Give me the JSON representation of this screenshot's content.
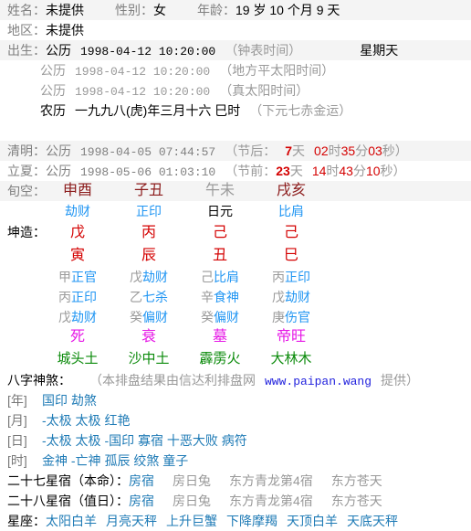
{
  "header": {
    "name_label": "姓名：",
    "name_value": "未提供",
    "gender_label": "性别：",
    "gender_value": "女",
    "age_label": "年龄：",
    "age_value": "19 岁 10 个月 9 天",
    "region_label": "地区：",
    "region_value": "未提供"
  },
  "birth": {
    "label": "出生：",
    "lines": [
      {
        "calendar": "公历",
        "datetime": "1998-04-12 10:20:00",
        "note": "（钟表时间）",
        "weekday": "星期天",
        "dim": false
      },
      {
        "calendar": "公历",
        "datetime": "1998-04-12 10:20:00",
        "note": "（地方平太阳时间）",
        "weekday": "",
        "dim": true
      },
      {
        "calendar": "公历",
        "datetime": "1998-04-12 10:20:00",
        "note": "（真太阳时间）",
        "weekday": "",
        "dim": true
      }
    ],
    "lunar": {
      "calendar": "农历",
      "text": "一九九八(虎)年三月十六  巳时",
      "note": "（下元七赤金运）"
    }
  },
  "terms": [
    {
      "name": "清明：",
      "calendar": "公历",
      "datetime": "1998-04-05 07:44:57",
      "prefix": "（节后：",
      "days": "7",
      "days_unit": "天",
      "hours": "02",
      "hours_unit": "时",
      "minutes": "35",
      "minutes_unit": "分",
      "seconds": "03",
      "seconds_unit": "秒）"
    },
    {
      "name": "立夏：",
      "calendar": "公历",
      "datetime": "1998-05-06 01:03:10",
      "prefix": "（节前：",
      "days": "23",
      "days_unit": "天",
      "hours": "14",
      "hours_unit": "时",
      "minutes": "43",
      "minutes_unit": "分",
      "seconds": "10",
      "seconds_unit": "秒）"
    }
  ],
  "chart": {
    "xunkong_label": "旬空：",
    "xunkong": [
      "申酉",
      "子丑",
      "午未",
      "戌亥"
    ],
    "xunkong_empty_index": 2,
    "tengod_top": [
      "劫财",
      "正印",
      "日元",
      "比肩"
    ],
    "tengod_top_daymaster_index": 2,
    "pillar_label": "坤造：",
    "heavenly_stems": [
      "戊",
      "丙",
      "己",
      "己"
    ],
    "earthly_branches": [
      "寅",
      "辰",
      "丑",
      "巳"
    ],
    "hidden": [
      [
        {
          "stem": "甲",
          "god": "正官"
        },
        {
          "stem": "戊",
          "god": "劫财"
        },
        {
          "stem": "己",
          "god": "比肩"
        },
        {
          "stem": "丙",
          "god": "正印"
        }
      ],
      [
        {
          "stem": "丙",
          "god": "正印"
        },
        {
          "stem": "乙",
          "god": "七杀"
        },
        {
          "stem": "辛",
          "god": "食神"
        },
        {
          "stem": "戊",
          "god": "劫财"
        }
      ],
      [
        {
          "stem": "戊",
          "god": "劫财"
        },
        {
          "stem": "癸",
          "god": "偏财"
        },
        {
          "stem": "癸",
          "god": "偏财"
        },
        {
          "stem": "庚",
          "god": "伤官"
        }
      ]
    ],
    "changsheng": [
      "死",
      "衰",
      "墓",
      "帝旺"
    ],
    "nayin": [
      "城头土",
      "沙中土",
      "霹雳火",
      "大林木"
    ]
  },
  "shensha": {
    "title": "八字神煞：",
    "credit": "（本排盘结果由信达利排盘网",
    "credit_url": "www.paipan.wang",
    "credit_tail": "提供）",
    "rows": [
      {
        "label": "[年]",
        "items": "国印  劫煞"
      },
      {
        "label": "[月]",
        "items": "-太极  太极  红艳"
      },
      {
        "label": "[日]",
        "items": "-太极  太极  -国印  寡宿  十恶大败  病符"
      },
      {
        "label": "[时]",
        "items": "金神  -亡神  孤辰  绞煞  童子"
      }
    ]
  },
  "stars": [
    {
      "label": "二十七星宿（本命）：",
      "main": "房宿",
      "rest": [
        "房日兔",
        "东方青龙第4宿",
        "东方苍天"
      ]
    },
    {
      "label": "二十八星宿（值日）：",
      "main": "房宿",
      "rest": [
        "房日兔",
        "东方青龙第4宿",
        "东方苍天"
      ]
    }
  ],
  "zodiac": {
    "label": "星座：",
    "items": [
      "太阳白羊",
      "月亮天秤",
      "上升巨蟹",
      "下降摩羯",
      "天顶白羊",
      "天底天秤"
    ]
  },
  "colors": {
    "red": "#d40000",
    "dark_red": "#8b1a1a",
    "blue": "#2196f3",
    "teal": "#1f7bb6",
    "green": "#0a8a0a",
    "magenta": "#e617e6",
    "gray": "#9a9a9a",
    "link": "#2222dd",
    "stripe": "#f4f4f4"
  }
}
